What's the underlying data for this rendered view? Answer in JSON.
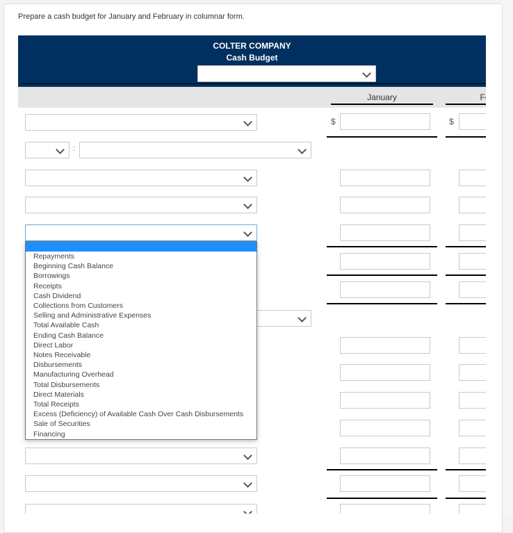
{
  "instructions": "Prepare a cash budget for January and February in columnar form.",
  "header": {
    "company": "COLTER COMPANY",
    "subtitle": "Cash Budget",
    "period_select": ""
  },
  "columns": [
    {
      "label": "January",
      "currency": "$"
    },
    {
      "label": "February",
      "currency": "$"
    }
  ],
  "dropdown": {
    "selected": "",
    "options": [
      "",
      "Repayments",
      "Beginning Cash Balance",
      "Borrowings",
      "Receipts",
      "Cash Dividend",
      "Collections from Customers",
      "Selling and Administrative Expenses",
      "Total Available Cash",
      "Ending Cash Balance",
      "Direct Labor",
      "Notes Receivable",
      "Disbursements",
      "Manufacturing Overhead",
      "Total Disbursements",
      "Direct Materials",
      "Total Receipts",
      "Excess (Deficiency) of Available Cash Over Cash Disbursements",
      "Sale of Securities",
      "Financing"
    ]
  },
  "colors": {
    "header_bg": "#00305f",
    "highlight": "#1e90ff",
    "band_bg": "#e5e5e5"
  }
}
